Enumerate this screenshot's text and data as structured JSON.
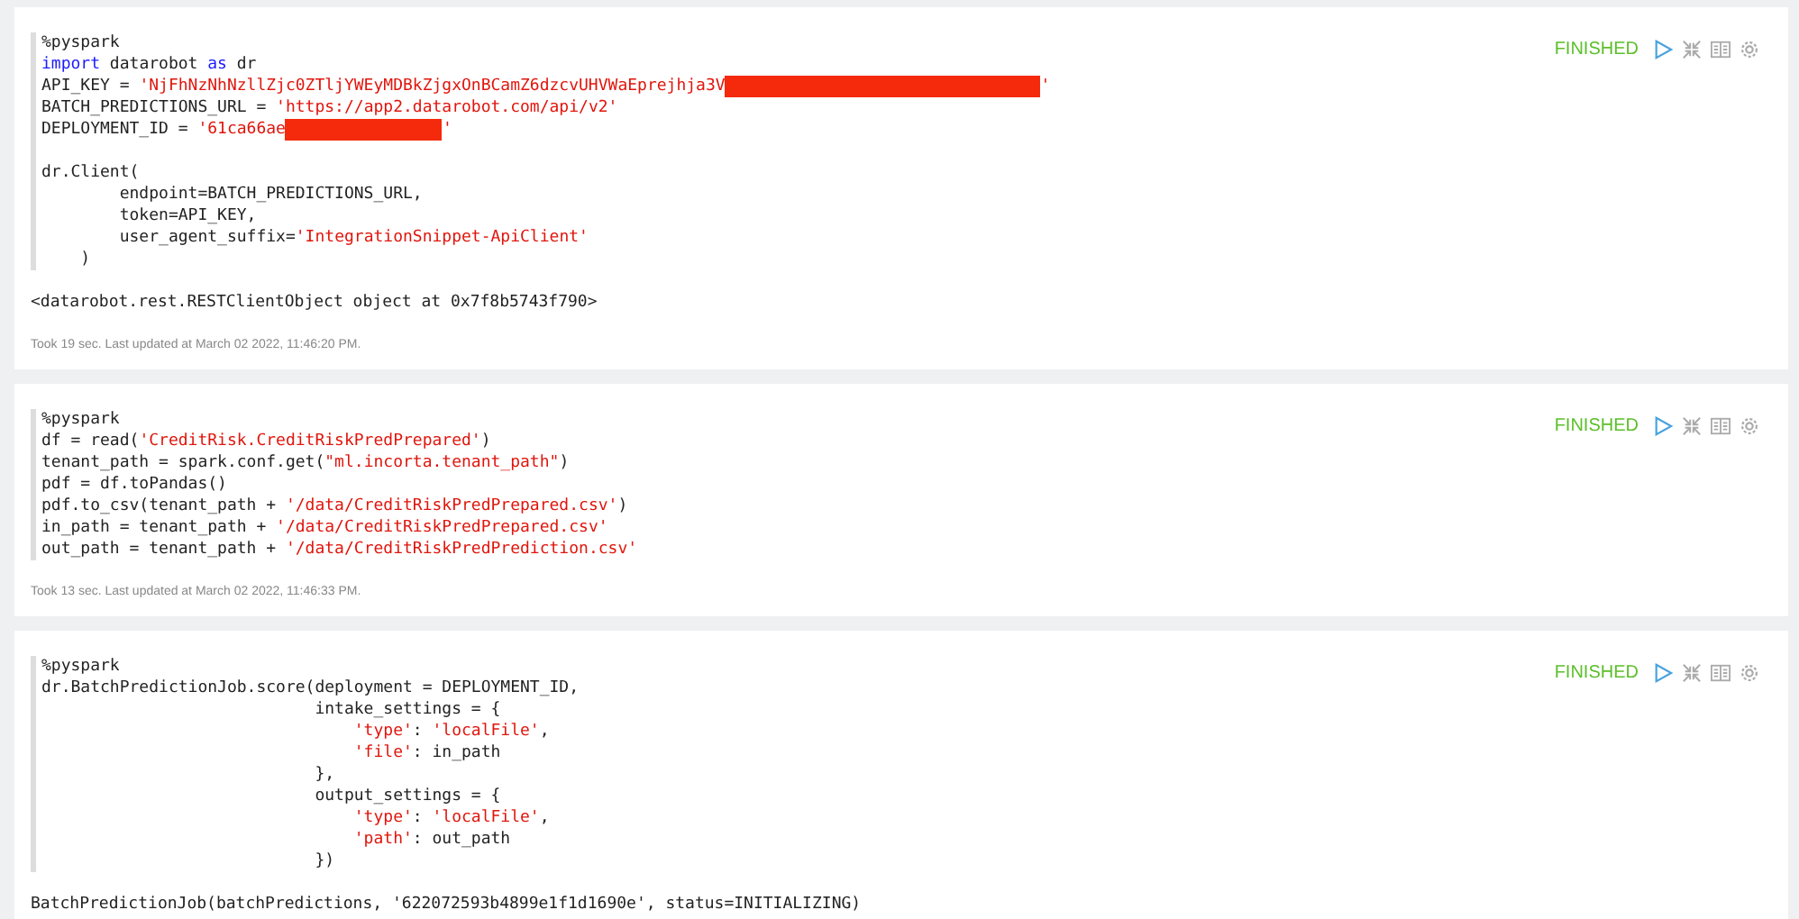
{
  "paragraphs": [
    {
      "status": "FINISHED",
      "code_blocks": [
        [
          {
            "tokens": [
              {
                "t": "%pyspark",
                "kind": "plain"
              }
            ]
          },
          {
            "tokens": [
              {
                "t": "import",
                "kind": "keyword"
              },
              {
                "t": " datarobot ",
                "kind": "plain"
              },
              {
                "t": "as",
                "kind": "keyword"
              },
              {
                "t": " dr",
                "kind": "plain"
              }
            ]
          },
          {
            "tokens": [
              {
                "t": "API_KEY = ",
                "kind": "plain"
              },
              {
                "t": "'NjFhNzNhNzllZjc0ZTljYWEyMDBkZjgxOnBCamZ6dzcvUHVWaEprejhja3V",
                "kind": "string"
              },
              {
                "kind": "redaction",
                "wide": true
              },
              {
                "t": "'",
                "kind": "string"
              }
            ]
          },
          {
            "tokens": [
              {
                "t": "BATCH_PREDICTIONS_URL = ",
                "kind": "plain"
              },
              {
                "t": "'https://app2.datarobot.com/api/v2'",
                "kind": "string"
              }
            ]
          },
          {
            "tokens": [
              {
                "t": "DEPLOYMENT_ID = ",
                "kind": "plain"
              },
              {
                "t": "'61ca66ae",
                "kind": "string"
              },
              {
                "kind": "redaction",
                "wide": false
              },
              {
                "t": "'",
                "kind": "string"
              }
            ]
          }
        ],
        [
          {
            "tokens": [
              {
                "t": "dr.Client(",
                "kind": "plain"
              }
            ]
          },
          {
            "tokens": [
              {
                "t": "        endpoint=BATCH_PREDICTIONS_URL,",
                "kind": "plain"
              }
            ]
          },
          {
            "tokens": [
              {
                "t": "        token=API_KEY,",
                "kind": "plain"
              }
            ]
          },
          {
            "tokens": [
              {
                "t": "        user_agent_suffix=",
                "kind": "plain"
              },
              {
                "t": "'IntegrationSnippet-ApiClient'",
                "kind": "string"
              }
            ]
          },
          {
            "tokens": [
              {
                "t": "    )",
                "kind": "plain"
              }
            ]
          }
        ]
      ],
      "output": "<datarobot.rest.RESTClientObject object at 0x7f8b5743f790>",
      "footer": "Took 19 sec. Last updated at March 02 2022, 11:46:20 PM."
    },
    {
      "status": "FINISHED",
      "code_blocks": [
        [
          {
            "tokens": [
              {
                "t": "%pyspark",
                "kind": "plain"
              }
            ]
          },
          {
            "tokens": [
              {
                "t": "df = read(",
                "kind": "plain"
              },
              {
                "t": "'CreditRisk.CreditRiskPredPrepared'",
                "kind": "string"
              },
              {
                "t": ")",
                "kind": "plain"
              }
            ]
          },
          {
            "tokens": [
              {
                "t": "tenant_path = spark.conf.get(",
                "kind": "plain"
              },
              {
                "t": "\"ml.incorta.tenant_path\"",
                "kind": "string"
              },
              {
                "t": ")",
                "kind": "plain"
              }
            ]
          },
          {
            "tokens": [
              {
                "t": "pdf = df.toPandas()",
                "kind": "plain"
              }
            ]
          },
          {
            "tokens": [
              {
                "t": "pdf.to_csv(tenant_path + ",
                "kind": "plain"
              },
              {
                "t": "'/data/CreditRiskPredPrepared.csv'",
                "kind": "string"
              },
              {
                "t": ")",
                "kind": "plain"
              }
            ]
          },
          {
            "tokens": [
              {
                "t": "in_path = tenant_path + ",
                "kind": "plain"
              },
              {
                "t": "'/data/CreditRiskPredPrepared.csv'",
                "kind": "string"
              }
            ]
          },
          {
            "tokens": [
              {
                "t": "out_path = tenant_path + ",
                "kind": "plain"
              },
              {
                "t": "'/data/CreditRiskPredPrediction.csv'",
                "kind": "string"
              }
            ]
          }
        ]
      ],
      "footer": "Took 13 sec. Last updated at March 02 2022, 11:46:33 PM."
    },
    {
      "status": "FINISHED",
      "code_blocks": [
        [
          {
            "tokens": [
              {
                "t": "%pyspark",
                "kind": "plain"
              }
            ]
          },
          {
            "tokens": [
              {
                "t": "dr.BatchPredictionJob.score(deployment = DEPLOYMENT_ID,",
                "kind": "plain"
              }
            ]
          },
          {
            "tokens": [
              {
                "t": "                            intake_settings = {",
                "kind": "plain"
              }
            ]
          },
          {
            "tokens": [
              {
                "t": "                                'type'",
                "kind": "string"
              },
              {
                "t": ": ",
                "kind": "plain"
              },
              {
                "t": "'localFile'",
                "kind": "string"
              },
              {
                "t": ",",
                "kind": "plain"
              }
            ]
          },
          {
            "tokens": [
              {
                "t": "                                'file'",
                "kind": "string"
              },
              {
                "t": ": in_path",
                "kind": "plain"
              }
            ]
          },
          {
            "tokens": [
              {
                "t": "                            },",
                "kind": "plain"
              }
            ]
          },
          {
            "tokens": [
              {
                "t": "                            output_settings = {",
                "kind": "plain"
              }
            ]
          },
          {
            "tokens": [
              {
                "t": "                                'type'",
                "kind": "string"
              },
              {
                "t": ": ",
                "kind": "plain"
              },
              {
                "t": "'localFile'",
                "kind": "string"
              },
              {
                "t": ",",
                "kind": "plain"
              }
            ]
          },
          {
            "tokens": [
              {
                "t": "                                'path'",
                "kind": "string"
              },
              {
                "t": ": out_path",
                "kind": "plain"
              }
            ]
          },
          {
            "tokens": [
              {
                "t": "                            })",
                "kind": "plain"
              }
            ]
          }
        ]
      ],
      "output": "BatchPredictionJob(batchPredictions, '622072593b4899e1f1d1690e', status=INITIALIZING)"
    }
  ]
}
